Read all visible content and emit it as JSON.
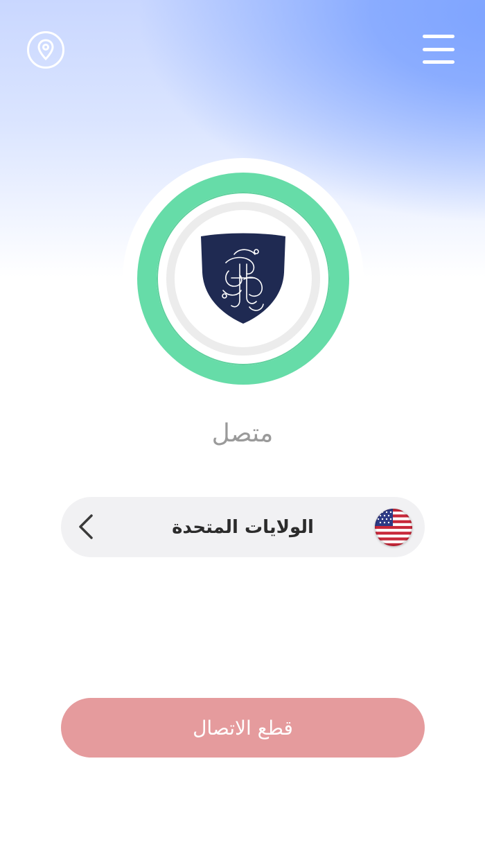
{
  "header": {
    "location_icon": "map-pin-icon",
    "menu_icon": "hamburger-menu-icon"
  },
  "connection": {
    "status": "متصل",
    "ring_color": "#66dca8",
    "logo_icon": "shield-logo-icon"
  },
  "server": {
    "country": "الولايات المتحدة",
    "flag_icon": "us-flag-icon",
    "chevron_icon": "chevron-left-icon"
  },
  "actions": {
    "disconnect_label": "قطع الاتصال",
    "disconnect_color": "#e59b9d"
  }
}
